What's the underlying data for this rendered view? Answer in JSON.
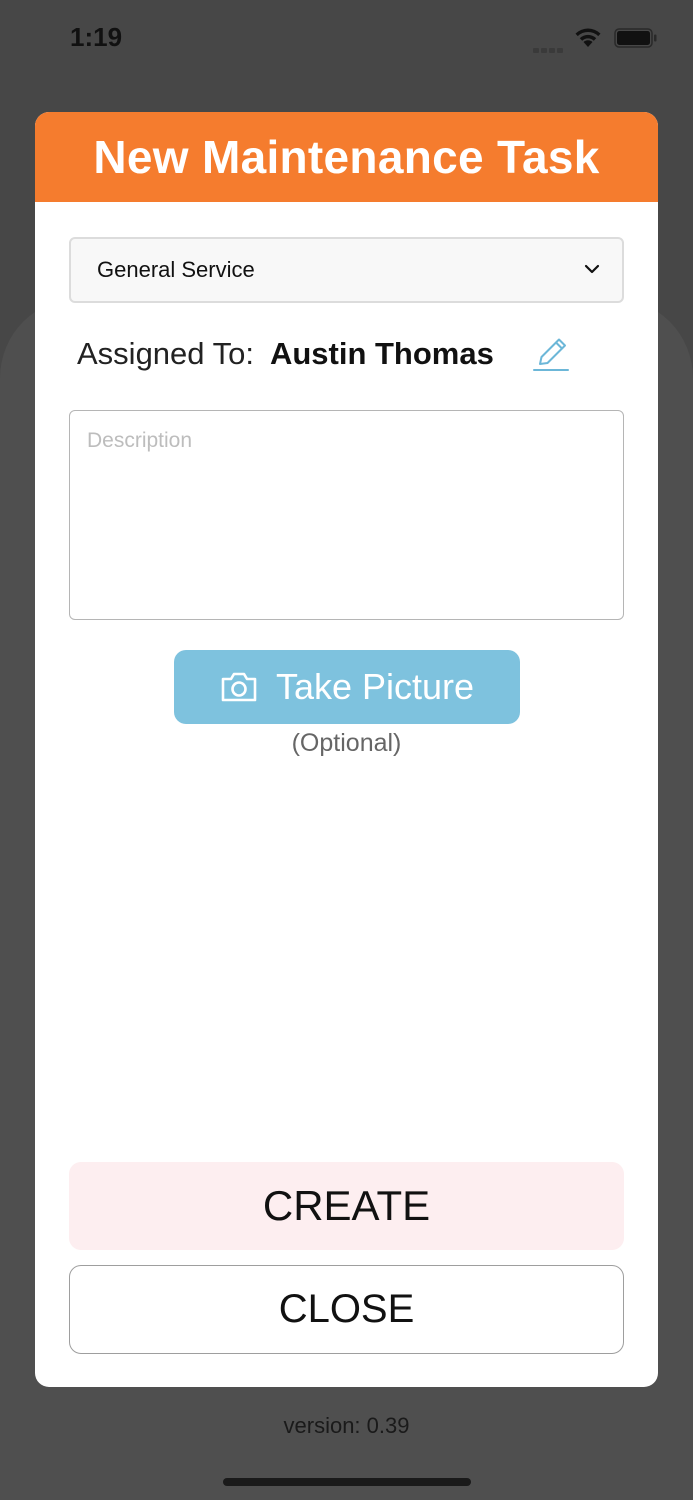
{
  "status_bar": {
    "time": "1:19"
  },
  "modal": {
    "title": "New Maintenance Task",
    "header_color": "#f57c2e",
    "category_select": {
      "value": "General Service"
    },
    "assigned": {
      "label": "Assigned To:",
      "name": "Austin Thomas"
    },
    "description": {
      "placeholder": "Description",
      "value": ""
    },
    "take_picture": {
      "label": "Take Picture",
      "note": "(Optional)",
      "color": "#7ec2de"
    },
    "create_label": "CREATE",
    "close_label": "CLOSE"
  },
  "footer": {
    "version": "version: 0.39"
  }
}
